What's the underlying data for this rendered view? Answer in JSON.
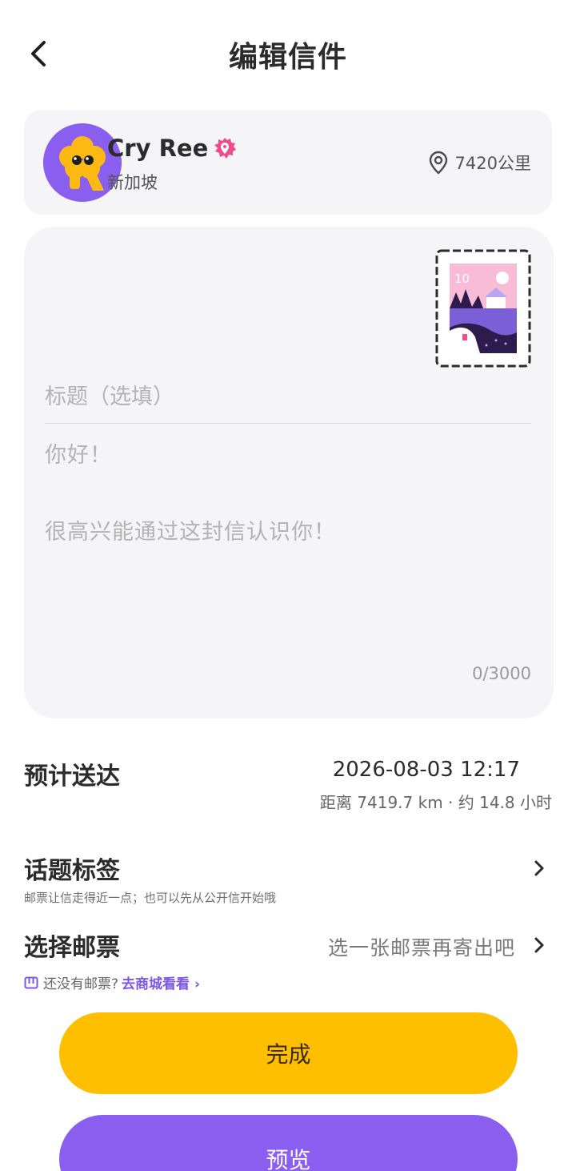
{
  "header": {
    "title": "编辑信件",
    "back_icon": "chevron-left-icon"
  },
  "recipient": {
    "name": "Cry Ree",
    "city": "新加坡",
    "distance": "7420公里",
    "avatar_color": "#8a5ff0",
    "badge_color": "#ee4d8a"
  },
  "letter": {
    "stamp_number": "10",
    "title_placeholder": "标题（选填）",
    "body_placeholder": "你好！\n\n很高兴能通过这封信认识你！",
    "char_count": "0/3000"
  },
  "delivery": {
    "label": "预计送达",
    "datetime": "2026-08-03 12:17",
    "detail": "距离 7419.7 km · 约 14.8 小时"
  },
  "topic": {
    "label": "话题标签",
    "subtitle": "邮票让信走得近一点；也可以先从公开信开始哦"
  },
  "stamp_select": {
    "label": "选择邮票",
    "hint": "选一张邮票再寄出吧"
  },
  "shop": {
    "text": "还没有邮票?",
    "link": "去商城看看 ›"
  },
  "buttons": {
    "done": "完成",
    "preview": "预览"
  },
  "colors": {
    "accent_yellow": "#fdbf00",
    "accent_purple": "#8a5ff0",
    "card_bg": "#f5f5f7"
  }
}
